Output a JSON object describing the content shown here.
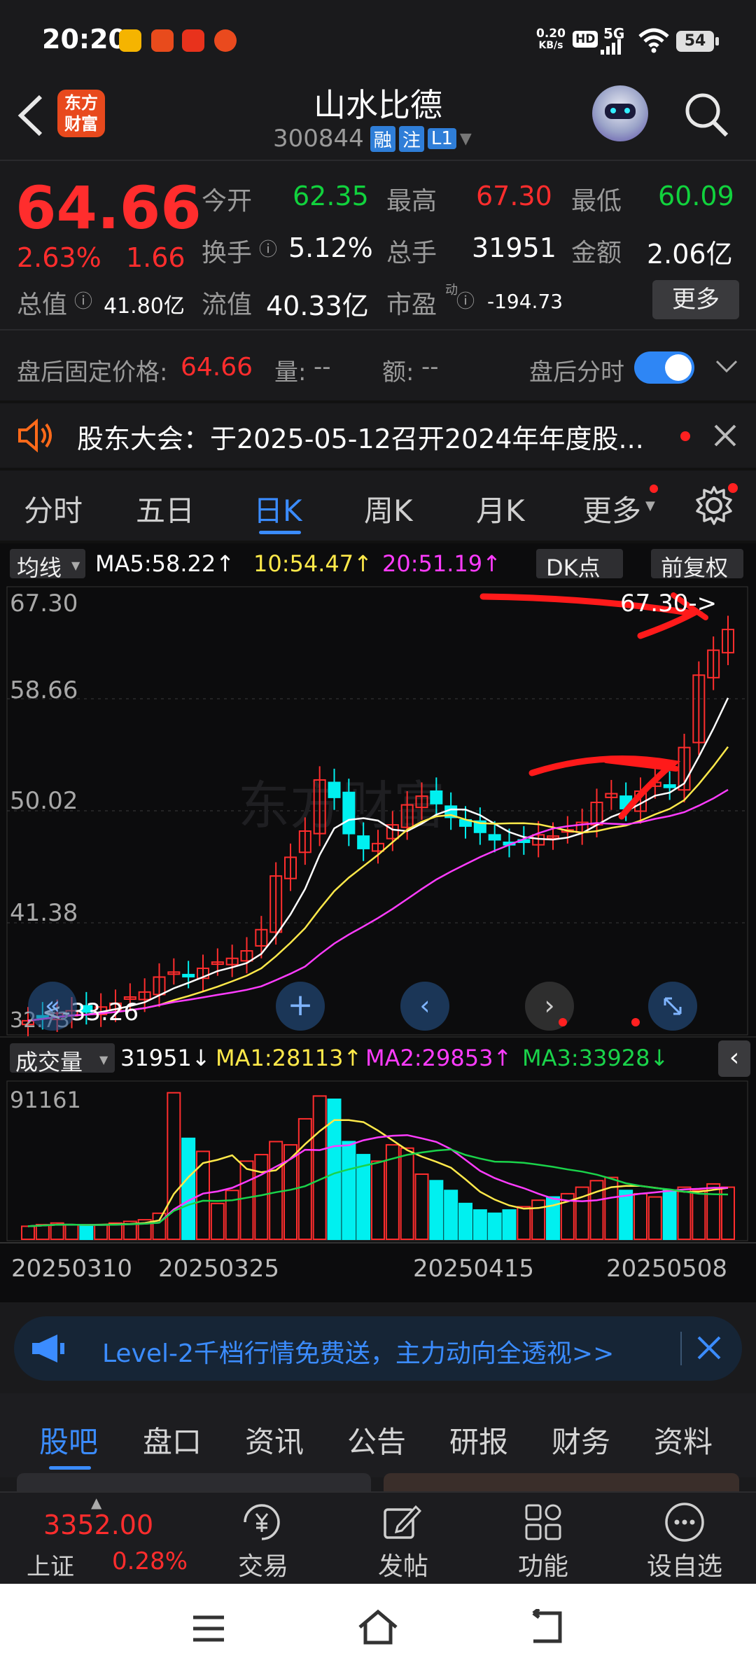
{
  "status_bar": {
    "time": "20:20",
    "net_speed": "0.20",
    "net_unit": "KB/s",
    "hd": "HD",
    "signal": "5G",
    "battery": "54"
  },
  "header": {
    "logo_line1": "东方",
    "logo_line2": "财富",
    "stock_name": "山水比德",
    "stock_code": "300844",
    "badges": [
      "融",
      "注",
      "L1"
    ]
  },
  "quote": {
    "price": "64.66",
    "change_pct": "2.63%",
    "change_amt": "1.66",
    "open_label": "今开",
    "open": "62.35",
    "high_label": "最高",
    "high": "67.30",
    "low_label": "最低",
    "low": "60.09",
    "turnover_label": "换手",
    "turnover": "5.12%",
    "volume_label": "总手",
    "volume": "31951",
    "amount_label": "金额",
    "amount": "2.06亿",
    "mktcap_label": "总值",
    "mktcap": "41.80亿",
    "float_label": "流值",
    "float_cap": "40.33亿",
    "pe_label": "市盈",
    "pe_sup": "动",
    "pe": "-194.73",
    "more_button": "更多"
  },
  "after_hours": {
    "label": "盘后固定价格:",
    "price": "64.66",
    "vol_label": "量:",
    "vol": "--",
    "amt_label": "额:",
    "amt": "--",
    "toggle_label": "盘后分时"
  },
  "notice": {
    "text": "股东大会：于2025-05-12召开2024年年度股..."
  },
  "tabs": [
    "分时",
    "五日",
    "日K",
    "周K",
    "月K",
    "更多"
  ],
  "ma_bar": {
    "indicator": "均线",
    "ma5": "MA5:58.22↑",
    "ma10": "10:54.47↑",
    "ma20": "20:51.19↑",
    "dk_button": "DK点",
    "adjust_button": "前复权"
  },
  "kline": {
    "y_labels": [
      "67.30",
      "58.66",
      "50.02",
      "41.38",
      "32.73"
    ],
    "high_marker": "67.30->",
    "low_marker": "<-33.26",
    "watermark": "东方财富"
  },
  "volume_bar": {
    "indicator": "成交量",
    "vol": "31951↓",
    "ma1": "MA1:28113↑",
    "ma2": "MA2:29853↑",
    "ma3": "MA3:33928↓",
    "max_label": "91161"
  },
  "dates": [
    "20250310",
    "20250325",
    "20250415",
    "20250508"
  ],
  "promo": {
    "text": "Level-2千档行情免费送，主力动向全透视>>"
  },
  "section_tabs": [
    "股吧",
    "盘口",
    "资讯",
    "公告",
    "研报",
    "财务",
    "资料"
  ],
  "bottom_nav": {
    "index_value": "3352.00",
    "index_name": "上证",
    "index_change": "0.28%",
    "items": [
      "交易",
      "发帖",
      "功能",
      "设自选"
    ]
  },
  "colors": {
    "up": "#ff2d2d",
    "down": "#11d23d",
    "accent": "#3b8cff",
    "cyan": "#00f0f0"
  }
}
